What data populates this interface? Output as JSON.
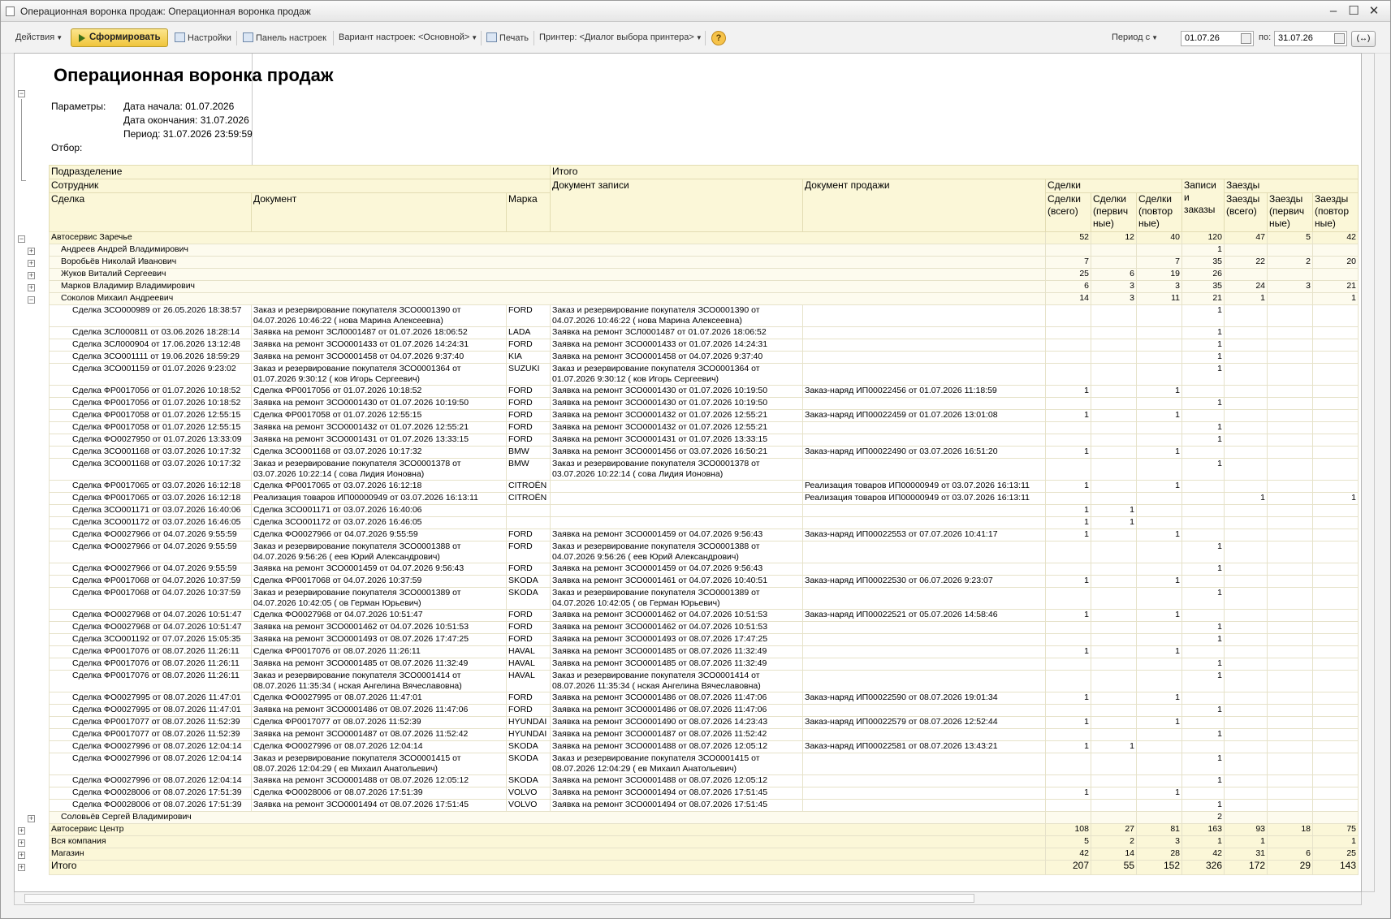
{
  "window": {
    "title": "Операционная воронка продаж: Операционная воронка продаж"
  },
  "toolbar": {
    "actions": "Действия",
    "generate": "Сформировать",
    "settings": "Настройки",
    "settings_panel": "Панель настроек",
    "variant": "Вариант настроек: <Основной>",
    "print": "Печать",
    "printer": "Принтер: <Диалог выбора принтера>",
    "help": "?",
    "period_label": "Период с",
    "date_from": "01.07.26",
    "to_label": "по:",
    "date_to": "31.07.26",
    "arrows": "(↔)"
  },
  "report": {
    "title": "Операционная воронка продаж",
    "params_label": "Параметры:",
    "param1": "Дата начала: 01.07.2026",
    "param2": "Дата окончания: 31.07.2026",
    "param3": "Период: 31.07.2026 23:59:59",
    "filter_label": "Отбор:"
  },
  "headers": {
    "division": "Подразделение",
    "total": "Итого",
    "employee": "Сотрудник",
    "doc_record": "Документ записи",
    "doc_sale": "Документ продажи",
    "deals": "Сделки",
    "records": "Записи и заказы",
    "visits": "Заезды",
    "deal": "Сделка",
    "document": "Документ",
    "brand": "Марка",
    "deals_all": "Сделки (всего)",
    "deals_first": "Сделки (первич ные)",
    "deals_rep": "Сделки (повтор ные)",
    "visits_all": "Заезды (всего)",
    "visits_first": "Заезды (первич ные)",
    "visits_rep": "Заезды (повтор ные)"
  },
  "rows": [
    {
      "t": "g",
      "a": "Автосервис Заречье",
      "n": [
        "52",
        "12",
        "40",
        "120",
        "47",
        "5",
        "42"
      ]
    },
    {
      "t": "e",
      "a": "Андреев Андрей Владимирович",
      "n": [
        "",
        "",
        "",
        "1",
        "",
        "",
        ""
      ]
    },
    {
      "t": "e",
      "a": "Воробьёв Николай Иванович",
      "n": [
        "7",
        "",
        "7",
        "35",
        "22",
        "2",
        "20"
      ]
    },
    {
      "t": "e",
      "a": "Жуков Виталий Сергеевич",
      "n": [
        "25",
        "6",
        "19",
        "26",
        "",
        "",
        ""
      ]
    },
    {
      "t": "e",
      "a": "Марков Владимир Владимирович",
      "n": [
        "6",
        "3",
        "3",
        "35",
        "24",
        "3",
        "21"
      ]
    },
    {
      "t": "e",
      "a": "Соколов Михаил Андреевич",
      "open": true,
      "n": [
        "14",
        "3",
        "11",
        "21",
        "1",
        "",
        "1"
      ]
    },
    {
      "t": "d",
      "a": "Сделка ЗСО000989 от 26.05.2026 18:38:57",
      "b": "Заказ и резервирование покупателя ЗСО0001390 от",
      "b2": "04.07.2026 10:46:22 (        нова Марина Алексеевна)",
      "m": "FORD",
      "c": "Заказ и резервирование покупателя ЗСО0001390 от",
      "c2": "04.07.2026 10:46:22 (        нова Марина Алексеевна)",
      "s": "",
      "n": [
        "",
        "",
        "",
        "1",
        "",
        "",
        ""
      ]
    },
    {
      "t": "d",
      "a": "Сделка ЗСЛ000811 от 03.06.2026 18:28:14",
      "b": "Заявка на ремонт ЗСЛ0001487 от 01.07.2026 18:06:52",
      "m": "LADA",
      "c": "Заявка на ремонт ЗСЛ0001487 от 01.07.2026 18:06:52",
      "s": "",
      "n": [
        "",
        "",
        "",
        "1",
        "",
        "",
        ""
      ]
    },
    {
      "t": "d",
      "a": "Сделка ЗСЛ000904 от 17.06.2026 13:12:48",
      "b": "Заявка на ремонт ЗСО0001433 от 01.07.2026 14:24:31",
      "m": "FORD",
      "c": "Заявка на ремонт ЗСО0001433 от 01.07.2026 14:24:31",
      "s": "",
      "n": [
        "",
        "",
        "",
        "1",
        "",
        "",
        ""
      ]
    },
    {
      "t": "d",
      "a": "Сделка ЗСО001111 от 19.06.2026 18:59:29",
      "b": "Заявка на ремонт ЗСО0001458 от 04.07.2026 9:37:40",
      "m": "KIA",
      "c": "Заявка на ремонт ЗСО0001458 от 04.07.2026 9:37:40",
      "s": "",
      "n": [
        "",
        "",
        "",
        "1",
        "",
        "",
        ""
      ]
    },
    {
      "t": "d",
      "a": "Сделка ЗСО001159 от 01.07.2026 9:23:02",
      "b": "Заказ и резервирование покупателя ЗСО0001364 от",
      "b2": "01.07.2026 9:30:12 (        ков Игорь Сергеевич)",
      "m": "SUZUKI",
      "c": "Заказ и резервирование покупателя ЗСО0001364 от",
      "c2": "01.07.2026 9:30:12 (        ков Игорь Сергеевич)",
      "s": "",
      "n": [
        "",
        "",
        "",
        "1",
        "",
        "",
        ""
      ]
    },
    {
      "t": "d",
      "a": "Сделка ФР0017056 от 01.07.2026 10:18:52",
      "b": "Сделка ФР0017056 от 01.07.2026 10:18:52",
      "m": "FORD",
      "c": "Заявка на ремонт ЗСО0001430 от 01.07.2026 10:19:50",
      "s": "Заказ-наряд ИП00022456 от 01.07.2026 11:18:59",
      "n": [
        "1",
        "",
        "1",
        "",
        "",
        "",
        ""
      ]
    },
    {
      "t": "d",
      "a": "Сделка ФР0017056 от 01.07.2026 10:18:52",
      "b": "Заявка на ремонт ЗСО0001430 от 01.07.2026 10:19:50",
      "m": "FORD",
      "c": "Заявка на ремонт ЗСО0001430 от 01.07.2026 10:19:50",
      "s": "",
      "n": [
        "",
        "",
        "",
        "1",
        "",
        "",
        ""
      ]
    },
    {
      "t": "d",
      "a": "Сделка ФР0017058 от 01.07.2026 12:55:15",
      "b": "Сделка ФР0017058 от 01.07.2026 12:55:15",
      "m": "FORD",
      "c": "Заявка на ремонт ЗСО0001432 от 01.07.2026 12:55:21",
      "s": "Заказ-наряд ИП00022459 от 01.07.2026 13:01:08",
      "n": [
        "1",
        "",
        "1",
        "",
        "",
        "",
        ""
      ]
    },
    {
      "t": "d",
      "a": "Сделка ФР0017058 от 01.07.2026 12:55:15",
      "b": "Заявка на ремонт ЗСО0001432 от 01.07.2026 12:55:21",
      "m": "FORD",
      "c": "Заявка на ремонт ЗСО0001432 от 01.07.2026 12:55:21",
      "s": "",
      "n": [
        "",
        "",
        "",
        "1",
        "",
        "",
        ""
      ]
    },
    {
      "t": "d",
      "a": "Сделка ФО0027950 от 01.07.2026 13:33:09",
      "b": "Заявка на ремонт ЗСО0001431 от 01.07.2026 13:33:15",
      "m": "FORD",
      "c": "Заявка на ремонт ЗСО0001431 от 01.07.2026 13:33:15",
      "s": "",
      "n": [
        "",
        "",
        "",
        "1",
        "",
        "",
        ""
      ]
    },
    {
      "t": "d",
      "a": "Сделка ЗСО001168 от 03.07.2026 10:17:32",
      "b": "Сделка ЗСО001168 от 03.07.2026 10:17:32",
      "m": "BMW",
      "c": "Заявка на ремонт ЗСО0001456 от 03.07.2026 16:50:21",
      "s": "Заказ-наряд ИП00022490 от 03.07.2026 16:51:20",
      "n": [
        "1",
        "",
        "1",
        "",
        "",
        "",
        ""
      ]
    },
    {
      "t": "d",
      "a": "Сделка ЗСО001168 от 03.07.2026 10:17:32",
      "b": "Заказ и резервирование покупателя ЗСО0001378 от",
      "b2": "03.07.2026 10:22:14 (        сова Лидия Ионовна)",
      "m": "BMW",
      "c": "Заказ и резервирование покупателя ЗСО0001378 от",
      "c2": "03.07.2026 10:22:14 (        сова Лидия Ионовна)",
      "s": "",
      "n": [
        "",
        "",
        "",
        "1",
        "",
        "",
        ""
      ]
    },
    {
      "t": "d",
      "a": "Сделка ФР0017065 от 03.07.2026 16:12:18",
      "b": "Сделка ФР0017065 от 03.07.2026 16:12:18",
      "m": "CITROËN",
      "c": "",
      "s": "Реализация товаров ИП00000949 от 03.07.2026 16:13:11",
      "n": [
        "1",
        "",
        "1",
        "",
        "",
        "",
        ""
      ]
    },
    {
      "t": "d",
      "a": "Сделка ФР0017065 от 03.07.2026 16:12:18",
      "b": "Реализация товаров ИП00000949 от 03.07.2026 16:13:11",
      "m": "CITROËN",
      "c": "",
      "s": "Реализация товаров ИП00000949 от 03.07.2026 16:13:11",
      "n": [
        "",
        "",
        "",
        "",
        "1",
        "",
        "1"
      ]
    },
    {
      "t": "d",
      "a": "Сделка ЗСО001171 от 03.07.2026 16:40:06",
      "b": "Сделка ЗСО001171 от 03.07.2026 16:40:06",
      "m": "",
      "c": "",
      "s": "",
      "n": [
        "1",
        "1",
        "",
        "",
        "",
        "",
        ""
      ]
    },
    {
      "t": "d",
      "a": "Сделка ЗСО001172 от 03.07.2026 16:46:05",
      "b": "Сделка ЗСО001172 от 03.07.2026 16:46:05",
      "m": "",
      "c": "",
      "s": "",
      "n": [
        "1",
        "1",
        "",
        "",
        "",
        "",
        ""
      ]
    },
    {
      "t": "d",
      "a": "Сделка ФО0027966 от 04.07.2026 9:55:59",
      "b": "Сделка ФО0027966 от 04.07.2026 9:55:59",
      "m": "FORD",
      "c": "Заявка на ремонт ЗСО0001459 от 04.07.2026 9:56:43",
      "s": "Заказ-наряд ИП00022553 от 07.07.2026 10:41:17",
      "n": [
        "1",
        "",
        "1",
        "",
        "",
        "",
        ""
      ]
    },
    {
      "t": "d",
      "a": "Сделка ФО0027966 от 04.07.2026 9:55:59",
      "b": "Заказ и резервирование покупателя ЗСО0001388 от",
      "b2": "04.07.2026 9:56:26 (        еев Юрий Александрович)",
      "m": "FORD",
      "c": "Заказ и резервирование покупателя ЗСО0001388 от",
      "c2": "04.07.2026 9:56:26 (        еев Юрий Александрович)",
      "s": "",
      "n": [
        "",
        "",
        "",
        "1",
        "",
        "",
        ""
      ]
    },
    {
      "t": "d",
      "a": "Сделка ФО0027966 от 04.07.2026 9:55:59",
      "b": "Заявка на ремонт ЗСО0001459 от 04.07.2026 9:56:43",
      "m": "FORD",
      "c": "Заявка на ремонт ЗСО0001459 от 04.07.2026 9:56:43",
      "s": "",
      "n": [
        "",
        "",
        "",
        "1",
        "",
        "",
        ""
      ]
    },
    {
      "t": "d",
      "a": "Сделка ФР0017068 от 04.07.2026 10:37:59",
      "b": "Сделка ФР0017068 от 04.07.2026 10:37:59",
      "m": "SKODA",
      "c": "Заявка на ремонт ЗСО0001461 от 04.07.2026 10:40:51",
      "s": "Заказ-наряд ИП00022530 от 06.07.2026 9:23:07",
      "n": [
        "1",
        "",
        "1",
        "",
        "",
        "",
        ""
      ]
    },
    {
      "t": "d",
      "a": "Сделка ФР0017068 от 04.07.2026 10:37:59",
      "b": "Заказ и резервирование покупателя ЗСО0001389 от",
      "b2": "04.07.2026 10:42:05 (        ов Герман Юрьевич)",
      "m": "SKODA",
      "c": "Заказ и резервирование покупателя ЗСО0001389 от",
      "c2": "04.07.2026 10:42:05 (        ов Герман Юрьевич)",
      "s": "",
      "n": [
        "",
        "",
        "",
        "1",
        "",
        "",
        ""
      ]
    },
    {
      "t": "d",
      "a": "Сделка ФО0027968 от 04.07.2026 10:51:47",
      "b": "Сделка ФО0027968 от 04.07.2026 10:51:47",
      "m": "FORD",
      "c": "Заявка на ремонт ЗСО0001462 от 04.07.2026 10:51:53",
      "s": "Заказ-наряд ИП00022521 от 05.07.2026 14:58:46",
      "n": [
        "1",
        "",
        "1",
        "",
        "",
        "",
        ""
      ]
    },
    {
      "t": "d",
      "a": "Сделка ФО0027968 от 04.07.2026 10:51:47",
      "b": "Заявка на ремонт ЗСО0001462 от 04.07.2026 10:51:53",
      "m": "FORD",
      "c": "Заявка на ремонт ЗСО0001462 от 04.07.2026 10:51:53",
      "s": "",
      "n": [
        "",
        "",
        "",
        "1",
        "",
        "",
        ""
      ]
    },
    {
      "t": "d",
      "a": "Сделка ЗСО001192 от 07.07.2026 15:05:35",
      "b": "Заявка на ремонт ЗСО0001493 от 08.07.2026 17:47:25",
      "m": "FORD",
      "c": "Заявка на ремонт ЗСО0001493 от 08.07.2026 17:47:25",
      "s": "",
      "n": [
        "",
        "",
        "",
        "1",
        "",
        "",
        ""
      ]
    },
    {
      "t": "d",
      "a": "Сделка ФР0017076 от 08.07.2026 11:26:11",
      "b": "Сделка ФР0017076 от 08.07.2026 11:26:11",
      "m": "HAVAL",
      "c": "Заявка на ремонт ЗСО0001485 от 08.07.2026 11:32:49",
      "s": "",
      "n": [
        "1",
        "",
        "1",
        "",
        "",
        "",
        ""
      ]
    },
    {
      "t": "d",
      "a": "Сделка ФР0017076 от 08.07.2026 11:26:11",
      "b": "Заявка на ремонт ЗСО0001485 от 08.07.2026 11:32:49",
      "m": "HAVAL",
      "c": "Заявка на ремонт ЗСО0001485 от 08.07.2026 11:32:49",
      "s": "",
      "n": [
        "",
        "",
        "",
        "1",
        "",
        "",
        ""
      ]
    },
    {
      "t": "d",
      "a": "Сделка ФР0017076 от 08.07.2026 11:26:11",
      "b": "Заказ и резервирование покупателя ЗСО0001414 от",
      "b2": "08.07.2026 11:35:34 (        нская Ангелина Вячеславовна)",
      "m": "HAVAL",
      "c": "Заказ и резервирование покупателя ЗСО0001414 от",
      "c2": "08.07.2026 11:35:34 (        нская Ангелина Вячеславовна)",
      "s": "",
      "n": [
        "",
        "",
        "",
        "1",
        "",
        "",
        ""
      ]
    },
    {
      "t": "d",
      "a": "Сделка ФО0027995 от 08.07.2026 11:47:01",
      "b": "Сделка ФО0027995 от 08.07.2026 11:47:01",
      "m": "FORD",
      "c": "Заявка на ремонт ЗСО0001486 от 08.07.2026 11:47:06",
      "s": "Заказ-наряд ИП00022590 от 08.07.2026 19:01:34",
      "n": [
        "1",
        "",
        "1",
        "",
        "",
        "",
        ""
      ]
    },
    {
      "t": "d",
      "a": "Сделка ФО0027995 от 08.07.2026 11:47:01",
      "b": "Заявка на ремонт ЗСО0001486 от 08.07.2026 11:47:06",
      "m": "FORD",
      "c": "Заявка на ремонт ЗСО0001486 от 08.07.2026 11:47:06",
      "s": "",
      "n": [
        "",
        "",
        "",
        "1",
        "",
        "",
        ""
      ]
    },
    {
      "t": "d",
      "a": "Сделка ФР0017077 от 08.07.2026 11:52:39",
      "b": "Сделка ФР0017077 от 08.07.2026 11:52:39",
      "m": "HYUNDAI",
      "c": "Заявка на ремонт ЗСО0001490 от 08.07.2026 14:23:43",
      "s": "Заказ-наряд ИП00022579 от 08.07.2026 12:52:44",
      "n": [
        "1",
        "",
        "1",
        "",
        "",
        "",
        ""
      ]
    },
    {
      "t": "d",
      "a": "Сделка ФР0017077 от 08.07.2026 11:52:39",
      "b": "Заявка на ремонт ЗСО0001487 от 08.07.2026 11:52:42",
      "m": "HYUNDAI",
      "c": "Заявка на ремонт ЗСО0001487 от 08.07.2026 11:52:42",
      "s": "",
      "n": [
        "",
        "",
        "",
        "1",
        "",
        "",
        ""
      ]
    },
    {
      "t": "d",
      "a": "Сделка ФО0027996 от 08.07.2026 12:04:14",
      "b": "Сделка ФО0027996 от 08.07.2026 12:04:14",
      "m": "SKODA",
      "c": "Заявка на ремонт ЗСО0001488 от 08.07.2026 12:05:12",
      "s": "Заказ-наряд ИП00022581 от 08.07.2026 13:43:21",
      "n": [
        "1",
        "1",
        "",
        "",
        "",
        "",
        ""
      ]
    },
    {
      "t": "d",
      "a": "Сделка ФО0027996 от 08.07.2026 12:04:14",
      "b": "Заказ и резервирование покупателя ЗСО0001415 от",
      "b2": "08.07.2026 12:04:29 (        ев Михаил Анатольевич)",
      "m": "SKODA",
      "c": "Заказ и резервирование покупателя ЗСО0001415 от",
      "c2": "08.07.2026 12:04:29 (        ев Михаил Анатольевич)",
      "s": "",
      "n": [
        "",
        "",
        "",
        "1",
        "",
        "",
        ""
      ]
    },
    {
      "t": "d",
      "a": "Сделка ФО0027996 от 08.07.2026 12:04:14",
      "b": "Заявка на ремонт ЗСО0001488 от 08.07.2026 12:05:12",
      "m": "SKODA",
      "c": "Заявка на ремонт ЗСО0001488 от 08.07.2026 12:05:12",
      "s": "",
      "n": [
        "",
        "",
        "",
        "1",
        "",
        "",
        ""
      ]
    },
    {
      "t": "d",
      "a": "Сделка ФО0028006 от 08.07.2026 17:51:39",
      "b": "Сделка ФО0028006 от 08.07.2026 17:51:39",
      "m": "VOLVO",
      "c": "Заявка на ремонт ЗСО0001494 от 08.07.2026 17:51:45",
      "s": "",
      "n": [
        "1",
        "",
        "1",
        "",
        "",
        "",
        ""
      ]
    },
    {
      "t": "d",
      "a": "Сделка ФО0028006 от 08.07.2026 17:51:39",
      "b": "Заявка на ремонт ЗСО0001494 от 08.07.2026 17:51:45",
      "m": "VOLVO",
      "c": "Заявка на ремонт ЗСО0001494 от 08.07.2026 17:51:45",
      "s": "",
      "n": [
        "",
        "",
        "",
        "1",
        "",
        "",
        ""
      ]
    },
    {
      "t": "e",
      "a": "Соловьёв Сергей Владимирович",
      "n": [
        "",
        "",
        "",
        "2",
        "",
        "",
        ""
      ]
    },
    {
      "t": "g",
      "a": "Автосервис Центр",
      "n": [
        "108",
        "27",
        "81",
        "163",
        "93",
        "18",
        "75"
      ]
    },
    {
      "t": "g",
      "a": "Вся компания",
      "n": [
        "5",
        "2",
        "3",
        "1",
        "1",
        "",
        "1"
      ]
    },
    {
      "t": "g",
      "a": "Магазин",
      "n": [
        "42",
        "14",
        "28",
        "42",
        "31",
        "6",
        "25"
      ]
    },
    {
      "t": "tot",
      "a": "Итого",
      "n": [
        "207",
        "55",
        "152",
        "326",
        "172",
        "29",
        "143"
      ]
    }
  ]
}
